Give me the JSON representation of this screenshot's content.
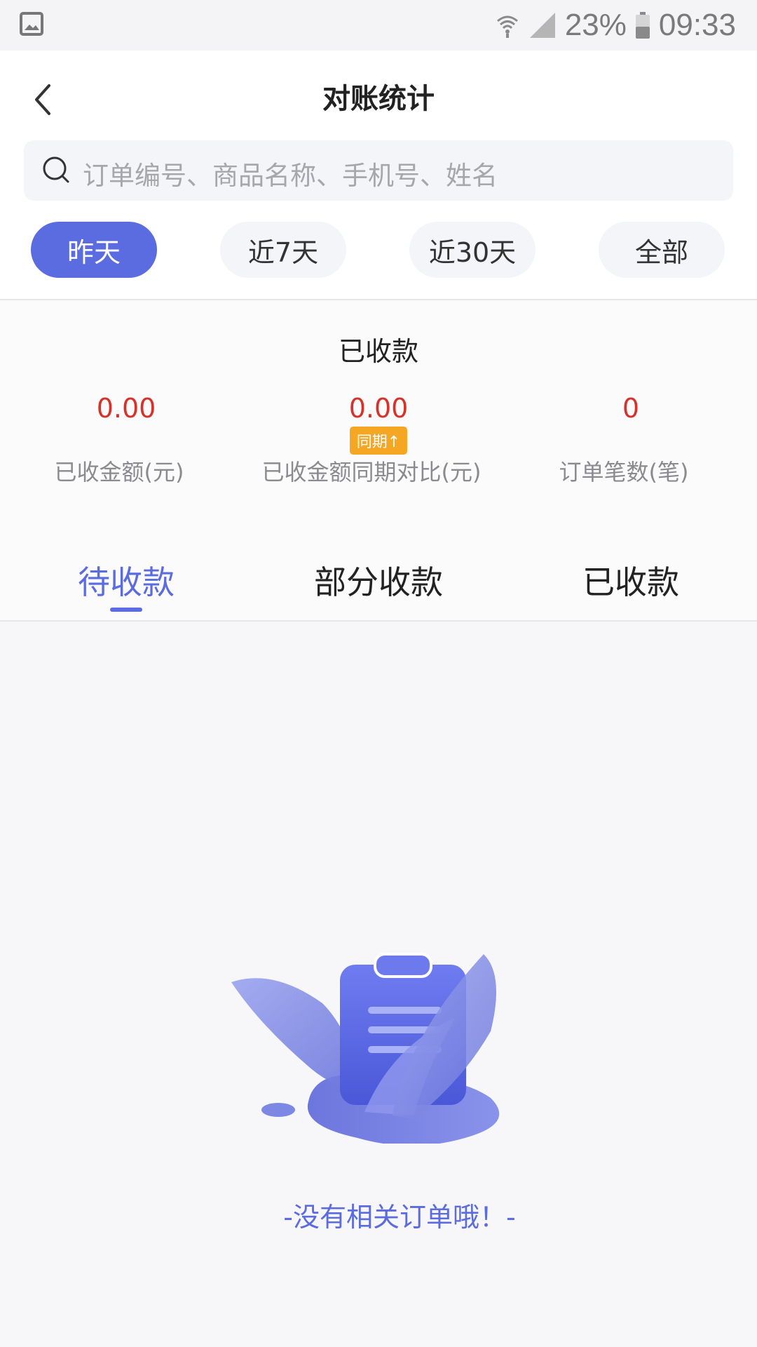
{
  "status_bar": {
    "battery_percent": "23%",
    "time": "09:33",
    "icons": [
      "image-icon",
      "wifi-icon",
      "signal-icon",
      "battery-icon"
    ]
  },
  "header": {
    "title": "对账统计",
    "back_icon": "chevron-left-icon"
  },
  "search": {
    "placeholder": "订单编号、商品名称、手机号、姓名"
  },
  "filters": [
    {
      "label": "昨天",
      "active": true
    },
    {
      "label": "近7天",
      "active": false
    },
    {
      "label": "近30天",
      "active": false
    },
    {
      "label": "全部",
      "active": false
    }
  ],
  "stats": {
    "title": "已收款",
    "items": [
      {
        "value": "0.00",
        "label": "已收金额(元)"
      },
      {
        "value": "0.00",
        "label": "已收金额同期对比(元)"
      },
      {
        "value": "0",
        "label": "订单笔数(笔)"
      }
    ],
    "badge": "同期↑"
  },
  "tabs": [
    {
      "label": "待收款",
      "active": true
    },
    {
      "label": "部分收款",
      "active": false
    },
    {
      "label": "已收款",
      "active": false
    }
  ],
  "empty": {
    "message": "-没有相关订单哦！-",
    "icon": "clipboard-illustration"
  },
  "colors": {
    "accent": "#5b6be0",
    "value_red": "#d6322a",
    "badge_orange": "#f5a623"
  }
}
